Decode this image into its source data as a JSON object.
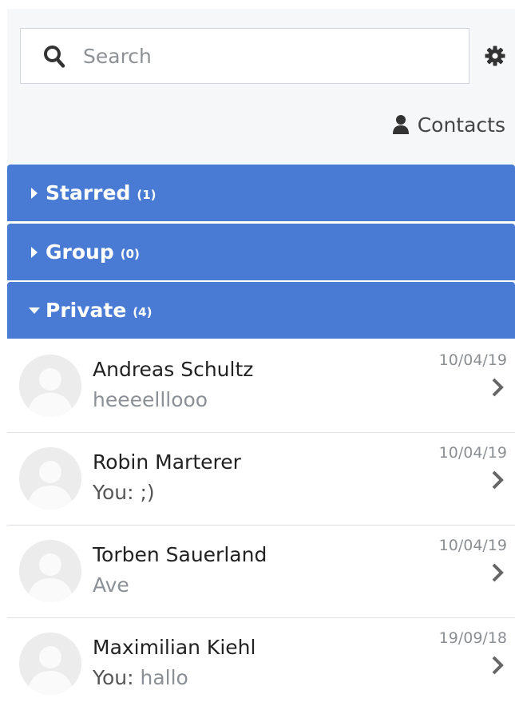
{
  "search": {
    "placeholder": "Search",
    "value": ""
  },
  "contacts_label": "Contacts",
  "colors": {
    "accent": "#4a7bd4",
    "header_bg": "#f5f7f9"
  },
  "groups": [
    {
      "name": "Starred",
      "count": "(1)",
      "expanded": false
    },
    {
      "name": "Group",
      "count": "(0)",
      "expanded": false
    },
    {
      "name": "Private",
      "count": "(4)",
      "expanded": true
    }
  ],
  "chats": [
    {
      "name": "Andreas Schultz",
      "you_prefix": "",
      "preview": "heeeelllooo",
      "date": "10/04/19"
    },
    {
      "name": "Robin Marterer",
      "you_prefix": "You: ",
      "preview": ";)",
      "date": "10/04/19"
    },
    {
      "name": "Torben Sauerland",
      "you_prefix": "",
      "preview": "Ave",
      "date": "10/04/19"
    },
    {
      "name": "Maximilian Kiehl",
      "you_prefix": "You: ",
      "preview": "hallo",
      "date": "19/09/18"
    }
  ]
}
